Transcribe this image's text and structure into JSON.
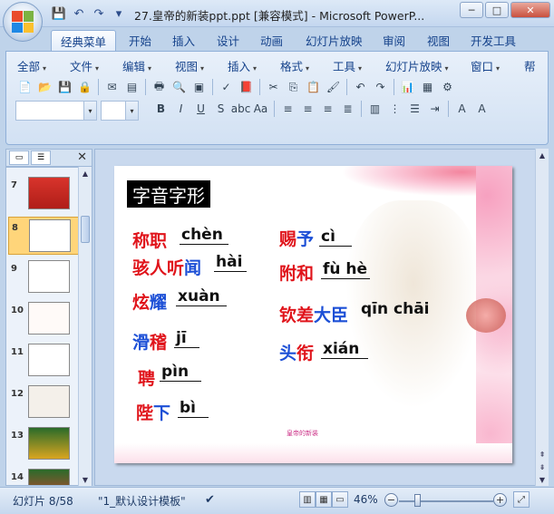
{
  "window": {
    "title": "27.皇帝的新装ppt.ppt [兼容模式] - Microsoft PowerP...",
    "minimize": "─",
    "maximize": "□",
    "close": "✕"
  },
  "ribbon_tabs": [
    "经典菜单",
    "开始",
    "插入",
    "设计",
    "动画",
    "幻灯片放映",
    "审阅",
    "视图",
    "开发工具"
  ],
  "menus": [
    "全部",
    "文件",
    "编辑",
    "视图",
    "插入",
    "格式",
    "工具",
    "幻灯片放映",
    "窗口",
    "帮"
  ],
  "slides_panel": {
    "numbers": [
      "7",
      "8",
      "9",
      "10",
      "11",
      "12",
      "13",
      "14"
    ],
    "selected": "8"
  },
  "slide": {
    "title": "字音字形",
    "items": [
      {
        "a": "称",
        "b": "职",
        "pinyin": "chèn"
      },
      {
        "a": "骇人听",
        "b": "闻",
        "pinyin": "hài"
      },
      {
        "a": "炫",
        "b": "耀",
        "pinyin": "xuàn"
      },
      {
        "a": "滑",
        "b": "稽",
        "pinyin": "jī"
      },
      {
        "a": "聘",
        "b": "",
        "pinyin": "pìn"
      },
      {
        "a": "陛",
        "b": "下",
        "pinyin": "bì"
      },
      {
        "a": "赐",
        "b": "予",
        "pinyin": "cì"
      },
      {
        "a": "附",
        "b": "和",
        "pinyin": "fù hè"
      },
      {
        "a": "钦差",
        "b": "大臣",
        "pinyin": "qīn chāi"
      },
      {
        "a": "头",
        "b": "衔",
        "pinyin": "xián"
      }
    ],
    "caption": "皇帝的新装"
  },
  "status": {
    "slide_info": "幻灯片 8/58",
    "template": "\"1_默认设计模板\"",
    "zoom": "46%",
    "zoom_minus": "−",
    "zoom_plus": "+"
  }
}
